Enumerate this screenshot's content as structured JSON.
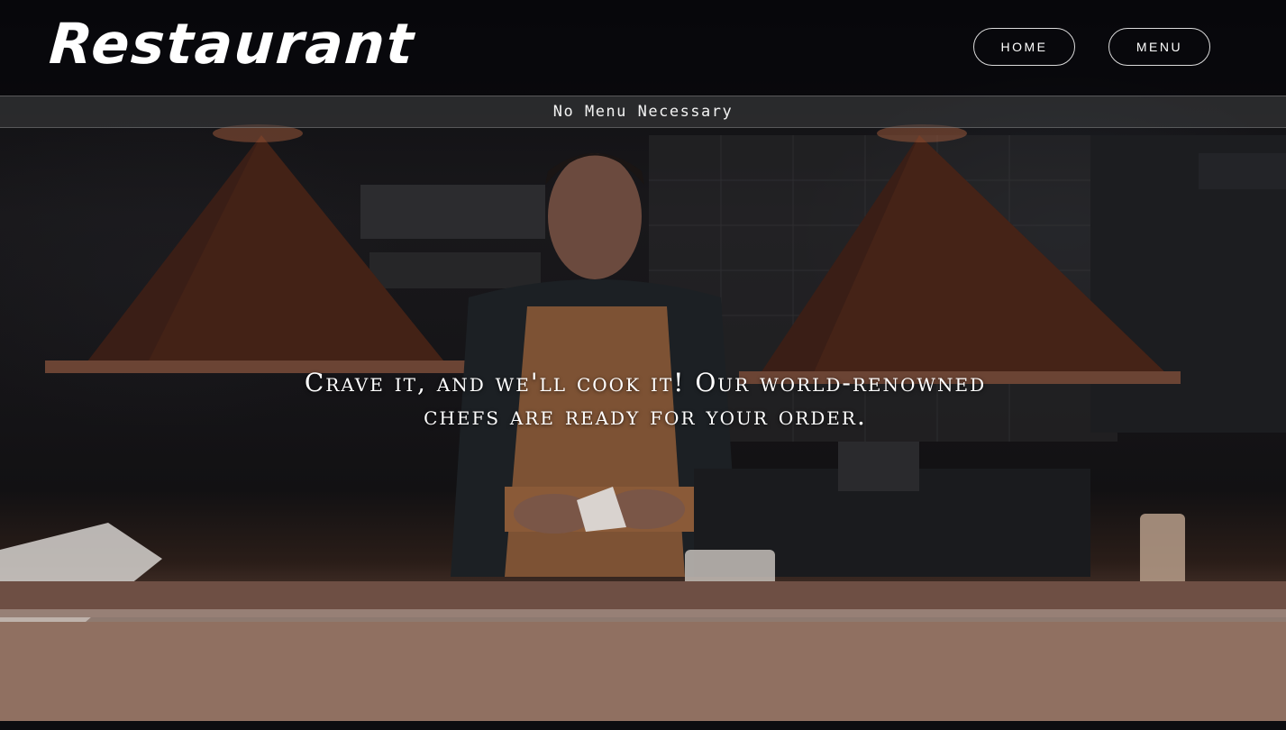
{
  "header": {
    "brand": "Restaurant",
    "nav": [
      {
        "label": "HOME"
      },
      {
        "label": "MENU"
      }
    ]
  },
  "tagline": "No Menu Necessary",
  "hero": {
    "headline": "Crave it, and we'll cook it! Our world-renowned chefs are ready for your order."
  }
}
